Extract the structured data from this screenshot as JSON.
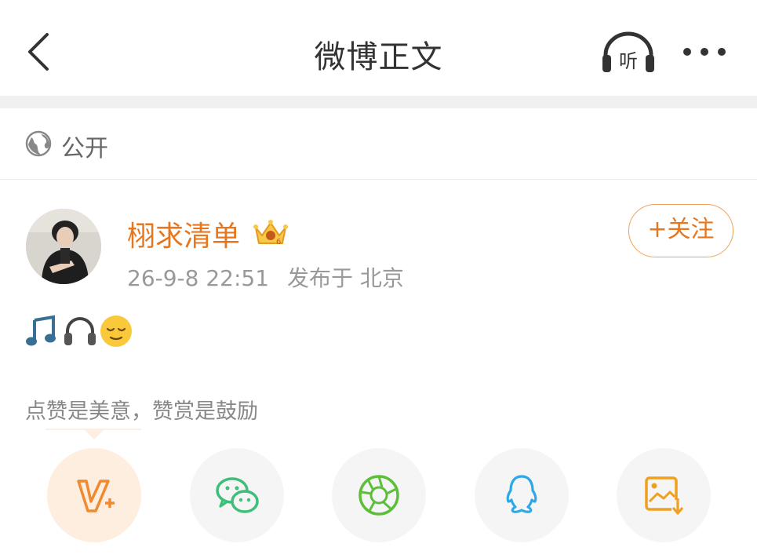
{
  "nav": {
    "title": "微博正文",
    "listen_label": "听"
  },
  "visibility": {
    "label": "公开"
  },
  "post": {
    "author": "栩求清单",
    "date": "26-9-8 22:51",
    "location": "发布于 北京",
    "follow_label": "+关注",
    "content_emojis": [
      "music-note-icon",
      "headphones-icon",
      "relieved-face-icon"
    ]
  },
  "reward_tip": "点赞是美意，赞赏是鼓励",
  "share": [
    {
      "icon": "v-plus-icon",
      "color": "#f08a2e"
    },
    {
      "icon": "wechat-icon",
      "color": "#3dbf7a"
    },
    {
      "icon": "moments-icon",
      "color": "#5cbf3a"
    },
    {
      "icon": "qq-icon",
      "color": "#2ea8e6"
    },
    {
      "icon": "save-image-icon",
      "color": "#f0a020"
    }
  ],
  "colors": {
    "accent": "#e8761c",
    "follow_border": "#f0a258",
    "text_gray": "#999999"
  }
}
